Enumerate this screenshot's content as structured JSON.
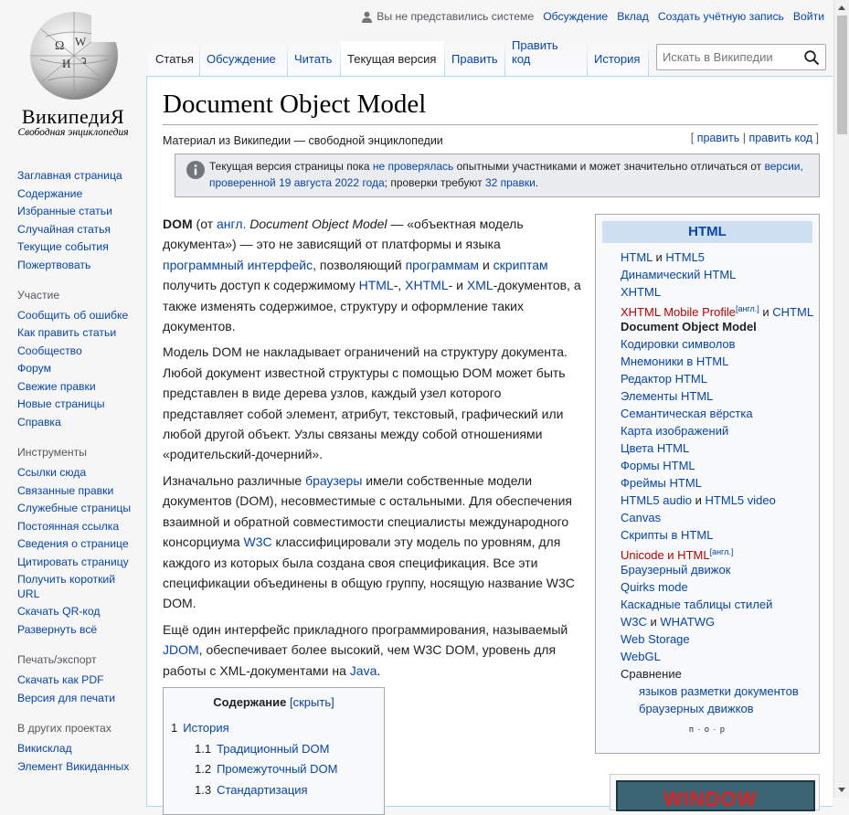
{
  "logo": {
    "wordmark": "ВикипедиЯ",
    "tagline": "Свободная энциклопедия"
  },
  "personal_tools": {
    "anon": "Вы не представились системе",
    "items": [
      "Обсуждение",
      "Вклад",
      "Создать учётную запись",
      "Войти"
    ]
  },
  "tabs": [
    "Статья",
    "Обсуждение",
    "Читать",
    "Текущая версия",
    "Править",
    "Править код",
    "История"
  ],
  "search": {
    "placeholder": "Искать в Википедии"
  },
  "sidebar": {
    "main": [
      "Заглавная страница",
      "Содержание",
      "Избранные статьи",
      "Случайная статья",
      "Текущие события",
      "Пожертвовать"
    ],
    "participation": {
      "title": "Участие",
      "items": [
        "Сообщить об ошибке",
        "Как править статьи",
        "Сообщество",
        "Форум",
        "Свежие правки",
        "Новые страницы",
        "Справка"
      ]
    },
    "tools": {
      "title": "Инструменты",
      "items": [
        "Ссылки сюда",
        "Связанные правки",
        "Служебные страницы",
        "Постоянная ссылка",
        "Сведения о странице",
        "Цитировать страницу",
        "Получить короткий URL",
        "Скачать QR-код",
        "Развернуть всё"
      ]
    },
    "print": {
      "title": "Печать/экспорт",
      "items": [
        "Скачать как PDF",
        "Версия для печати"
      ]
    },
    "projects": {
      "title": "В других проектах",
      "items": [
        "Викисклад",
        "Элемент Викиданных"
      ]
    }
  },
  "article": {
    "title": "Document Object Model",
    "sitesub": "Материал из Википедии — свободной энциклопедии",
    "edit_links": {
      "open": "[ ",
      "edit": "править",
      "sep": " | ",
      "edit_code": "править код",
      "close": " ]"
    },
    "notice": {
      "t1": "Текущая версия страницы пока ",
      "l1": "не проверялась",
      "t2": " опытными участниками и может значительно отличаться от ",
      "l2": "версии, проверенной 19 августа 2022 года",
      "t3": "; проверки требуют ",
      "l3": "32 правки",
      "t4": "."
    },
    "p1": {
      "b": "DOM",
      "a": " (от ",
      "l_angl": "англ.",
      "sp": " ",
      "i": "Document Object Model",
      "b2": " — «объектная модель документа») — это не зависящий от платформы и языка ",
      "l_api": "программный интерфейс",
      "c": ", позволяющий ",
      "l_prog": "программам",
      "d": " и ",
      "l_scr": "скриптам",
      "e": " получить доступ к содержимому ",
      "l_html": "HTML",
      "f": "-, ",
      "l_xhtml": "XHTML",
      "g": "- и ",
      "l_xml": "XML",
      "h": "-документов, а также изменять содержимое, структуру и оформление таких документов."
    },
    "p2": "Модель DOM не накладывает ограничений на структуру документа. Любой документ известной структуры с помощью DOM может быть представлен в виде дерева узлов, каждый узел которого представляет собой элемент, атрибут, текстовый, графический или любой другой объект. Узлы связаны между собой отношениями «родительский-дочерний».",
    "p3": {
      "a": "Изначально различные ",
      "l_br": "браузеры",
      "b": " имели собственные модели документов (DOM), несовместимые с остальными. Для обеспечения взаимной и обратной совместимости специалисты международного консорциума ",
      "l_w3c": "W3C",
      "c": " классифицировали эту модель по уровням, для каждого из которых была создана своя спецификация. Все эти спецификации объединены в общую группу, носящую название W3C DOM."
    },
    "p4": {
      "a": "Ещё один интерфейс прикладного программирования, называемый ",
      "l_jdom": "JDOM",
      "b": ", обеспечивает более высокий, чем W3C DOM, уровень для работы с XML-документами на ",
      "l_java": "Java",
      "c": "."
    }
  },
  "toc": {
    "title": "Содержание",
    "toggle": "[скрыть]",
    "items": [
      {
        "num": "1",
        "label": "История"
      },
      {
        "num": "1.1",
        "label": "Традиционный DOM"
      },
      {
        "num": "1.2",
        "label": "Промежуточный DOM"
      },
      {
        "num": "1.3",
        "label": "Стандартизация"
      }
    ]
  },
  "navbox": {
    "title": "HTML",
    "items": {
      "i1a": "HTML",
      "i1b": " и ",
      "i1c": "HTML5",
      "i2": "Динамический HTML",
      "i3": "XHTML",
      "i4a": "XHTML Mobile Profile",
      "i4sup": "[англ.]",
      "i4b": " и ",
      "i4c": "CHTML",
      "i5": "Document Object Model",
      "i6": "Кодировки символов",
      "i7": "Мнемоники в HTML",
      "i8": "Редактор HTML",
      "i9": "Элементы HTML",
      "i10": "Семантическая вёрстка",
      "i11": "Карта изображений",
      "i12": "Цвета HTML",
      "i13": "Формы HTML",
      "i14": "Фреймы HTML",
      "i15a": "HTML5 audio",
      "i15b": " и ",
      "i15c": "HTML5 video",
      "i16": "Canvas",
      "i17": "Скрипты в HTML",
      "i18a": "Unicode и HTML",
      "i18sup": "[англ.]",
      "i19": "Браузерный движок",
      "i20": "Quirks mode",
      "i21": "Каскадные таблицы стилей",
      "i22a": "W3C",
      "i22b": " и ",
      "i22c": "WHATWG",
      "i23": "Web Storage",
      "i24": "WebGL",
      "i25": "Сравнение",
      "i26": "языков разметки документов",
      "i27": "браузерных движков"
    },
    "vte": "п · о · р"
  },
  "image_caption": "WINDOW"
}
